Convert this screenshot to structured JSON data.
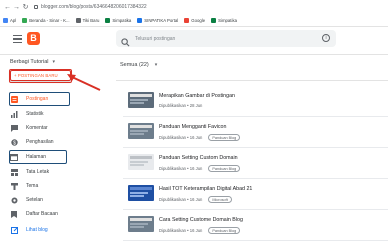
{
  "browser": {
    "url": "blogger.com/blog/posts/6346648206017384322",
    "bookmarks": [
      {
        "label": "Apl",
        "color": "#4285f4"
      },
      {
        "label": "Beranda - Sinar - K...",
        "color": "#34a853"
      },
      {
        "label": "Tiki Baru",
        "color": "#5f6368"
      },
      {
        "label": "Simpatika",
        "color": "#0b8043"
      },
      {
        "label": "SINPATIKA Portal",
        "color": "#1a73e8"
      },
      {
        "label": "Google",
        "color": "#ea4335"
      },
      {
        "label": "Simpatika",
        "color": "#0b8043"
      }
    ]
  },
  "header": {
    "search_placeholder": "Telusuri postingan",
    "help_glyph": "i"
  },
  "sidebar": {
    "blog_name": "Berbagi Tutorial",
    "new_post_label": "+ POSTINGAN BARU",
    "items": [
      {
        "label": "Postingan",
        "icon": "posts-icon",
        "active": true
      },
      {
        "label": "Statistik",
        "icon": "stats-icon",
        "active": false
      },
      {
        "label": "Komentar",
        "icon": "comments-icon",
        "active": false
      },
      {
        "label": "Penghasilan",
        "icon": "earnings-icon",
        "active": false
      },
      {
        "label": "Halaman",
        "icon": "pages-icon",
        "active": false
      },
      {
        "label": "Tata Letak",
        "icon": "layout-icon",
        "active": false
      },
      {
        "label": "Tema",
        "icon": "theme-icon",
        "active": false
      },
      {
        "label": "Setelan",
        "icon": "settings-icon",
        "active": false
      },
      {
        "label": "Daftar Bacaan",
        "icon": "reading-list-icon",
        "active": false
      },
      {
        "label": "Lihat blog",
        "icon": "view-blog-icon",
        "active": false
      }
    ]
  },
  "main": {
    "filter_label": "Semua (22)",
    "posts": [
      {
        "title": "Merapikan Gambar di Postingan",
        "meta": "Dipublikasikan • 28 Jun",
        "chip": ""
      },
      {
        "title": "Panduan Mengganti Favicon",
        "meta": "Dipublikasikan • 16 Jun",
        "chip": "Panduan Blog"
      },
      {
        "title": "Panduan Setting Custom Domain",
        "meta": "Dipublikasikan • 16 Jun",
        "chip": "Panduan Blog"
      },
      {
        "title": "Hasil TOT Keterampilan Digital Abad 21",
        "meta": "Dipublikasikan • 16 Jun",
        "chip": "Microsoft"
      },
      {
        "title": "Cara Setting Custome Domain Blog",
        "meta": "Dipublikasikan • 16 Jun",
        "chip": "Panduan Blog"
      }
    ]
  },
  "colors": {
    "accent": "#ff5722",
    "highlight_box": "#1f4e79",
    "annotation_red": "#d93025"
  }
}
